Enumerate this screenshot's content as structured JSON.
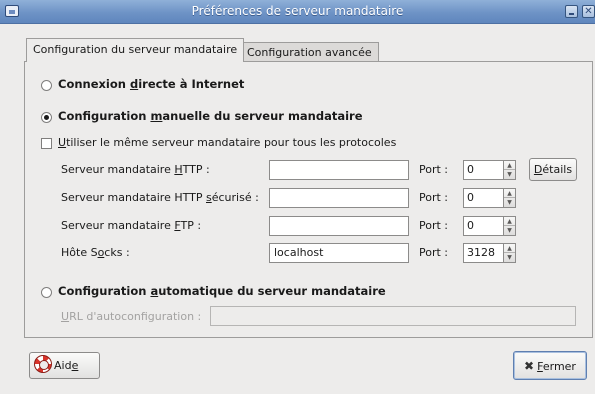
{
  "window": {
    "title": "Préférences de serveur mandataire",
    "close_glyph": "✕"
  },
  "tabs": [
    {
      "label": "Configuration du serveur mandataire",
      "selected": true
    },
    {
      "label": "Configuration avancée",
      "selected": false
    }
  ],
  "connection_modes": {
    "direct": {
      "pre": "Connexion ",
      "mnemonic": "d",
      "post": "irecte à Internet",
      "checked": false
    },
    "manual": {
      "pre": "Configuration ",
      "mnemonic": "m",
      "post": "anuelle du serveur mandataire",
      "checked": true
    },
    "auto": {
      "pre": "Configuration ",
      "mnemonic": "a",
      "post": "utomatique du serveur mandataire",
      "checked": false
    }
  },
  "same_proxy": {
    "mnemonic": "U",
    "post": "tiliser le même serveur mandataire pour tous les protocoles",
    "checked": false
  },
  "proxies": [
    {
      "label_pre": "Serveur mandataire ",
      "label_mnemonic": "H",
      "label_post": "TTP :",
      "host": "",
      "port": "0"
    },
    {
      "label_pre": "Serveur mandataire HTTP ",
      "label_mnemonic": "s",
      "label_post": "écurisé :",
      "host": "",
      "port": "0"
    },
    {
      "label_pre": "Serveur mandataire ",
      "label_mnemonic": "F",
      "label_post": "TP :",
      "host": "",
      "port": "0"
    },
    {
      "label_pre": "Hôte S",
      "label_mnemonic": "o",
      "label_post": "cks :",
      "host": "localhost",
      "port": "3128"
    }
  ],
  "port_label": "Port :",
  "details_button": {
    "pre": "",
    "mnemonic": "D",
    "post": "étails"
  },
  "autoconfig": {
    "mnemonic": "U",
    "post": "RL d'autoconfiguration :",
    "value": ""
  },
  "footer": {
    "help": {
      "pre": "Aid",
      "mnemonic": "e",
      "post": ""
    },
    "close": {
      "pre": "",
      "mnemonic": "F",
      "post": "ermer",
      "glyph": "✖"
    }
  },
  "spin_glyphs": {
    "up": "▲",
    "down": "▼"
  }
}
